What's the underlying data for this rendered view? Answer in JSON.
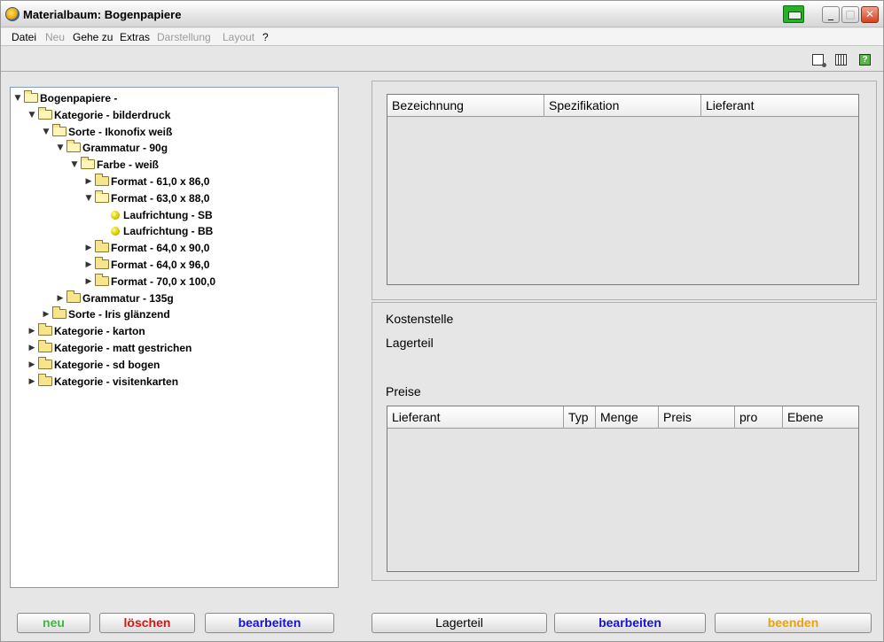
{
  "window": {
    "title": "Materialbaum: Bogenpapiere",
    "minimize_glyph": "_",
    "maximize_glyph": "□",
    "close_glyph": "✕"
  },
  "menu": [
    "Datei",
    "Neu",
    "Gehe zu",
    "Extras",
    "Darstellung",
    "Layout",
    "?"
  ],
  "menu_disabled": [
    "Neu",
    "Darstellung",
    "Layout"
  ],
  "toolbar": {
    "icons": [
      "new-document-icon",
      "calculator-icon",
      "help-icon"
    ],
    "help_glyph": "?"
  },
  "tree": {
    "expanded_glyph": "▼",
    "collapsed_glyph": "▶",
    "nodes": [
      {
        "label": "Bogenpapiere -",
        "expanded": true,
        "type": "folder"
      },
      {
        "label": "Kategorie - bilderdruck",
        "expanded": true,
        "type": "folder"
      },
      {
        "label": "Sorte - Ikonofix weiß",
        "expanded": true,
        "type": "folder"
      },
      {
        "label": "Grammatur - 90g",
        "expanded": true,
        "type": "folder"
      },
      {
        "label": "Farbe - weiß",
        "expanded": true,
        "type": "folder"
      },
      {
        "label": "Format - 61,0 x 86,0",
        "expanded": false,
        "type": "folder"
      },
      {
        "label": "Format - 63,0 x 88,0",
        "expanded": true,
        "type": "folder"
      },
      {
        "label": "Laufrichtung - SB",
        "type": "leaf"
      },
      {
        "label": "Laufrichtung - BB",
        "type": "leaf"
      },
      {
        "label": "Format - 64,0 x 90,0",
        "expanded": false,
        "type": "folder"
      },
      {
        "label": "Format - 64,0 x 96,0",
        "expanded": false,
        "type": "folder"
      },
      {
        "label": "Format - 70,0 x 100,0",
        "expanded": false,
        "type": "folder"
      },
      {
        "label": "Grammatur - 135g",
        "expanded": false,
        "type": "folder"
      },
      {
        "label": "Sorte - Iris glänzend",
        "expanded": false,
        "type": "folder"
      },
      {
        "label": "Kategorie - karton",
        "expanded": false,
        "type": "folder"
      },
      {
        "label": "Kategorie - matt gestrichen",
        "expanded": false,
        "type": "folder"
      },
      {
        "label": "Kategorie - sd bogen",
        "expanded": false,
        "type": "folder"
      },
      {
        "label": "Kategorie - visitenkarten",
        "expanded": false,
        "type": "folder"
      }
    ]
  },
  "materials_table": {
    "columns": [
      "Bezeichnung",
      "Spezifikation",
      "Lieferant"
    ],
    "rows": []
  },
  "details": {
    "kostenstelle_label": "Kostenstelle",
    "lagerteil_label": "Lagerteil",
    "preise_label": "Preise"
  },
  "prices_table": {
    "columns": [
      "Lieferant",
      "Typ",
      "Menge",
      "Preis",
      "pro",
      "Ebene"
    ],
    "rows": []
  },
  "buttons": {
    "neu": "neu",
    "loeschen": "löschen",
    "bearbeiten_left": "bearbeiten",
    "lagerteil": "Lagerteil",
    "bearbeiten_right": "bearbeiten",
    "beenden": "beenden"
  },
  "colors": {
    "neu": "#3cb93c",
    "loeschen": "#e01010",
    "bearbeiten": "#1414d2",
    "beenden": "#f0a000"
  }
}
